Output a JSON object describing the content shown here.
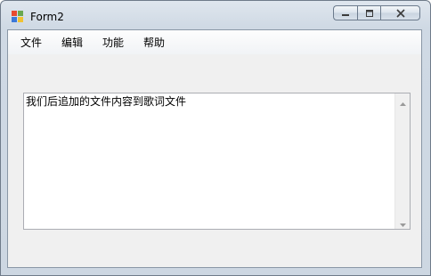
{
  "window": {
    "title": "Form2",
    "icons": {
      "app": "windows-form-icon",
      "minimize": "minimize-icon",
      "maximize": "maximize-icon",
      "close": "close-icon"
    }
  },
  "menu": {
    "items": [
      {
        "label": "文件"
      },
      {
        "label": "编辑"
      },
      {
        "label": "功能"
      },
      {
        "label": "帮助"
      }
    ]
  },
  "textbox": {
    "value": "我们后追加的文件内容到歌词文件"
  },
  "colors": {
    "frame": "#cfd9e4",
    "client": "#f0f0f0",
    "textbox_border": "#abadb3"
  }
}
